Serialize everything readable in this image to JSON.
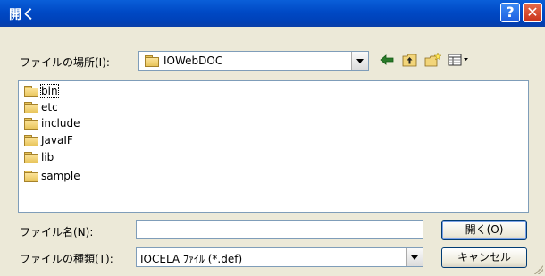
{
  "window": {
    "title": "開く",
    "help_label": "?",
    "close_label": "✕"
  },
  "look_in": {
    "label": "ファイルの場所(I):",
    "value": "IOWebDOC"
  },
  "toolbar": {
    "back_icon": "back-arrow-icon",
    "up_icon": "up-folder-icon",
    "new_folder_icon": "new-folder-icon",
    "view_menu_icon": "view-menu-icon"
  },
  "files": [
    {
      "name": "bin",
      "icon": "folder-icon"
    },
    {
      "name": "etc",
      "icon": "folder-icon"
    },
    {
      "name": "include",
      "icon": "folder-icon"
    },
    {
      "name": "JavaIF",
      "icon": "folder-icon"
    },
    {
      "name": "lib",
      "icon": "folder-icon"
    },
    {
      "name": "sample",
      "icon": "folder-icon"
    }
  ],
  "filename": {
    "label": "ファイル名(N):",
    "value": ""
  },
  "filetype": {
    "label": "ファイルの種類(T):",
    "value": "IOCELA ﾌｧｲﾙ (*.def)"
  },
  "buttons": {
    "open": "開く(O)",
    "cancel": "キャンセル"
  }
}
